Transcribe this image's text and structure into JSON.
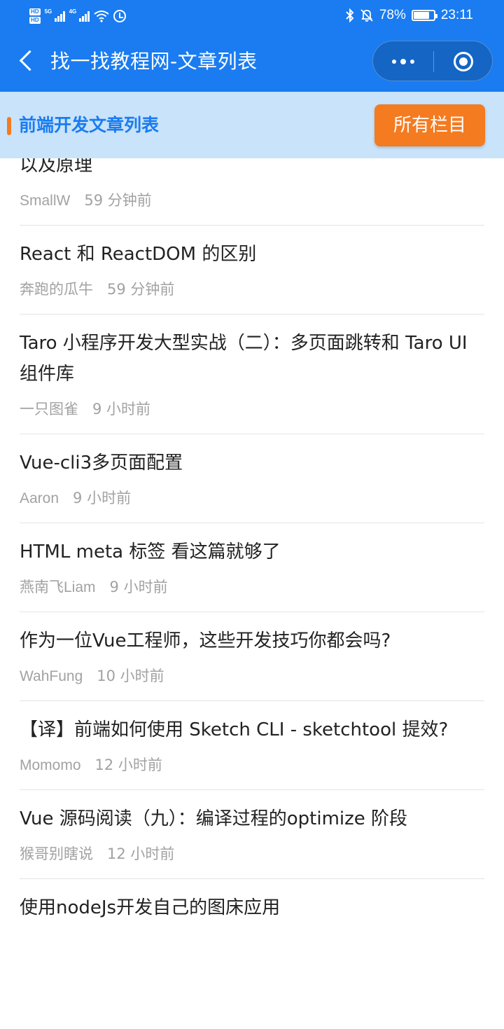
{
  "status_bar": {
    "hd_labels": [
      "HD",
      "HD"
    ],
    "network_labels": [
      "5G",
      "4G"
    ],
    "battery_level": 0.78,
    "battery_text": "78%",
    "time": "23:11"
  },
  "nav": {
    "title": "找一找教程网-文章列表",
    "icons": [
      "back-chevron-icon",
      "more-dots-icon",
      "close-target-icon"
    ]
  },
  "section": {
    "title": "前端开发文章列表",
    "button_label": "所有栏目",
    "accent_color": "#f47b20",
    "brand_color": "#1a7cf0"
  },
  "articles": [
    {
      "title": "以及原理",
      "author": "SmallW",
      "time": "59 分钟前"
    },
    {
      "title": "React 和 ReactDOM 的区别",
      "author": "奔跑的瓜牛",
      "time": "59 分钟前"
    },
    {
      "title": "Taro 小程序开发大型实战（二）：多页面跳转和 Taro UI 组件库",
      "author": "一只图雀",
      "time": "9 小时前"
    },
    {
      "title": "Vue-cli3多页面配置",
      "author": "Aaron",
      "time": "9 小时前"
    },
    {
      "title": "HTML meta 标签 看这篇就够了",
      "author": "燕南飞Liam",
      "time": "9 小时前"
    },
    {
      "title": "作为一位Vue工程师，这些开发技巧你都会吗?",
      "author": "WahFung",
      "time": "10 小时前"
    },
    {
      "title": "【译】前端如何使用 Sketch CLI - sketchtool 提效?",
      "author": "Momomo",
      "time": "12 小时前"
    },
    {
      "title": "Vue 源码阅读（九）：编译过程的optimize 阶段",
      "author": "猴哥别瞎说",
      "time": "12 小时前"
    },
    {
      "title": "使用nodeJs开发自己的图床应用",
      "author": "",
      "time": ""
    }
  ]
}
